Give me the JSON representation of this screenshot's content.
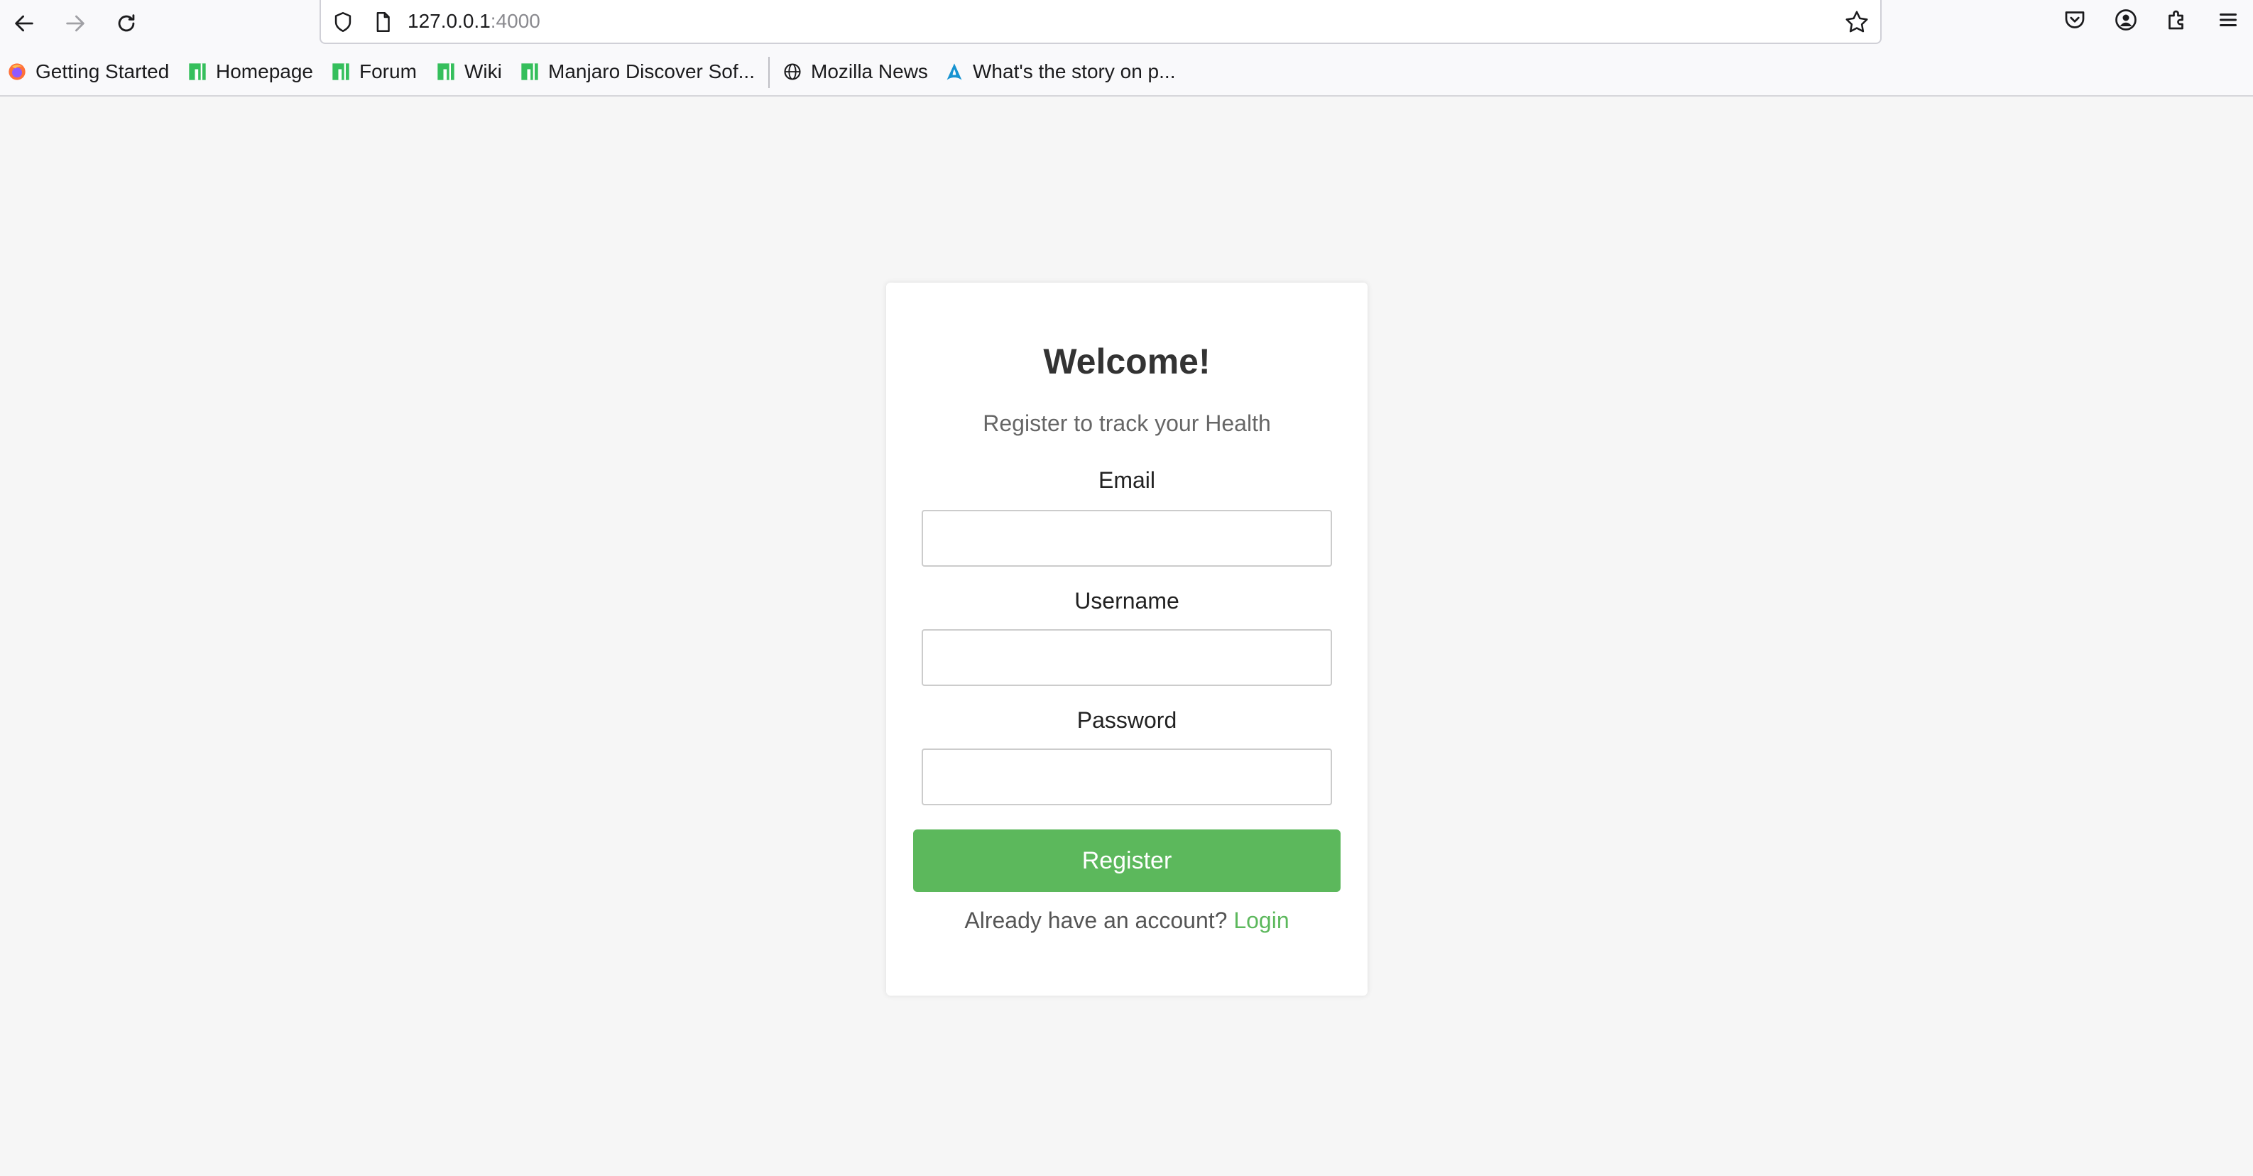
{
  "browser": {
    "url_host": "127.0.0.1",
    "url_port": ":4000",
    "bookmarks": [
      {
        "label": "Getting Started",
        "icon": "firefox-icon"
      },
      {
        "label": "Homepage",
        "icon": "manjaro-icon"
      },
      {
        "label": "Forum",
        "icon": "manjaro-icon"
      },
      {
        "label": "Wiki",
        "icon": "manjaro-icon"
      },
      {
        "label": "Manjaro Discover Sof...",
        "icon": "manjaro-icon"
      },
      {
        "label": "Mozilla News",
        "icon": "globe-icon"
      },
      {
        "label": "What's the story on p...",
        "icon": "arch-icon"
      }
    ]
  },
  "form": {
    "title": "Welcome!",
    "subtitle": "Register to track your Health",
    "email_label": "Email",
    "email_value": "",
    "username_label": "Username",
    "username_value": "",
    "password_label": "Password",
    "password_value": "",
    "submit_label": "Register",
    "footer_text": "Already have an account? ",
    "login_link": "Login"
  },
  "colors": {
    "accent": "#5cb85c",
    "background": "#f6f6f6",
    "card": "#ffffff"
  }
}
